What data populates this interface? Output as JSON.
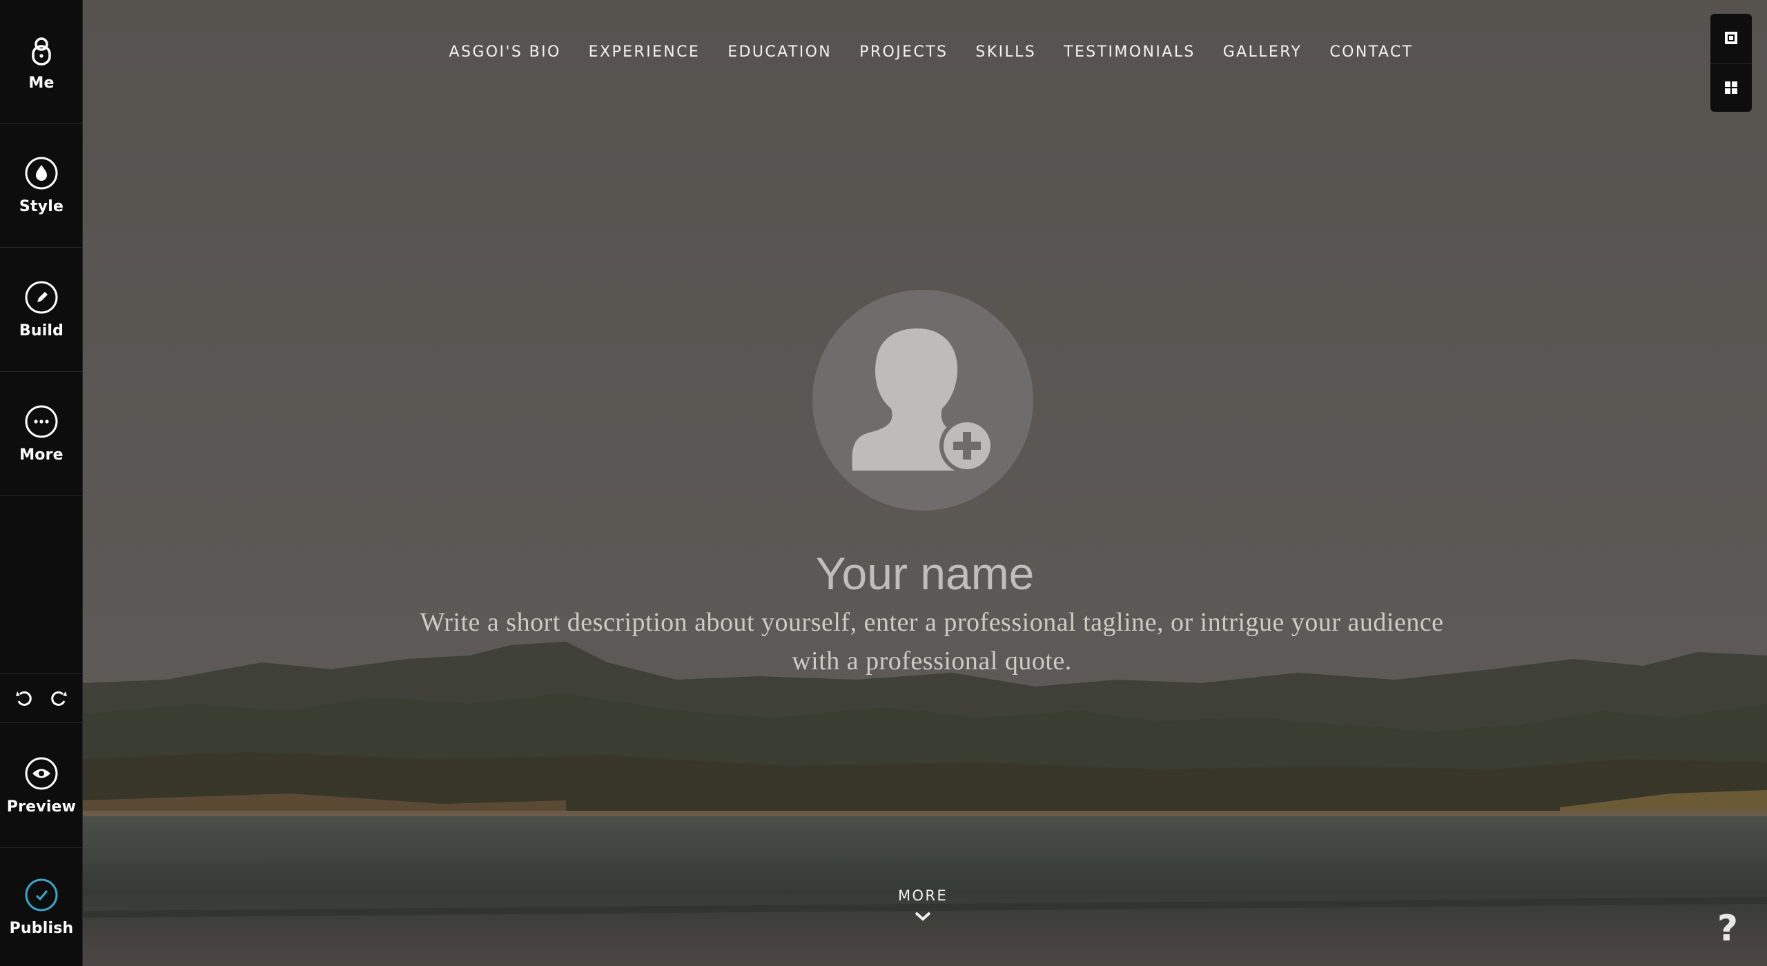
{
  "sidebar": {
    "me": {
      "label": "Me",
      "icon": "user-lock-icon"
    },
    "style": {
      "label": "Style",
      "icon": "drop-icon"
    },
    "build": {
      "label": "Build",
      "icon": "pencil-icon"
    },
    "more": {
      "label": "More",
      "icon": "ellipsis-icon"
    },
    "undo": {
      "icon": "undo-icon"
    },
    "redo": {
      "icon": "redo-icon"
    },
    "preview": {
      "label": "Preview",
      "icon": "eye-icon"
    },
    "publish": {
      "label": "Publish",
      "icon": "check-circle-icon"
    }
  },
  "nav": {
    "items": [
      "ASGOI'S BIO",
      "EXPERIENCE",
      "EDUCATION",
      "PROJECTS",
      "SKILLS",
      "TESTIMONIALS",
      "GALLERY",
      "CONTACT"
    ]
  },
  "hero": {
    "name": "Your name",
    "tagline": "Write a short description about yourself, enter a professional tagline, or intrigue your audience with a professional quote.",
    "avatar_icon": "add-profile-photo-icon",
    "more_label": "MORE",
    "more_icon": "chevron-down-icon"
  },
  "corner_tools": {
    "icons": [
      "section-settings-icon",
      "layout-grid-icon"
    ]
  },
  "help": {
    "label": "?"
  },
  "colors": {
    "sidebar_bg": "#0d0d0d",
    "publish_accent": "#3aa6c8",
    "overlay": "#5b5856"
  }
}
